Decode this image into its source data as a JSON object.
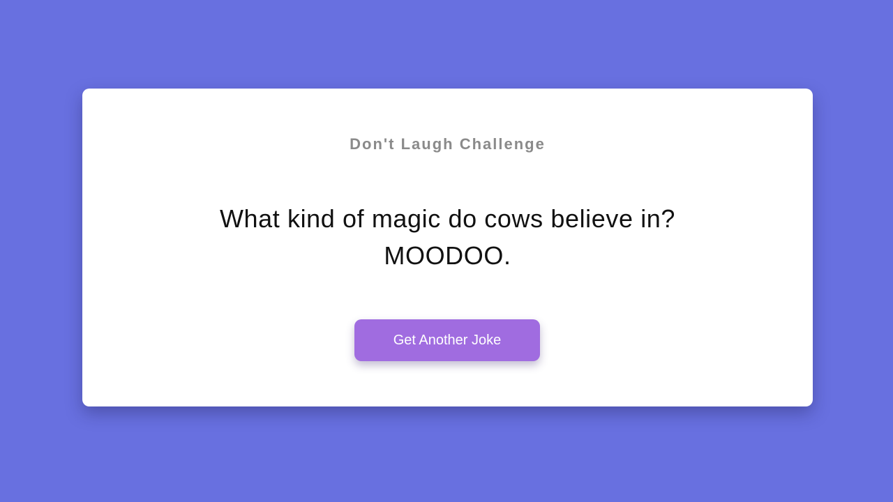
{
  "app": {
    "title": "Don't Laugh Challenge"
  },
  "joke": {
    "setup": "What kind of magic do cows believe in?",
    "punchline": "MOODOO."
  },
  "actions": {
    "next_joke_label": "Get Another Joke"
  },
  "colors": {
    "background": "#6870e0",
    "card": "#ffffff",
    "title": "#8a8a8a",
    "text": "#111111",
    "button": "#a06ce0",
    "button_text": "#ffffff"
  }
}
